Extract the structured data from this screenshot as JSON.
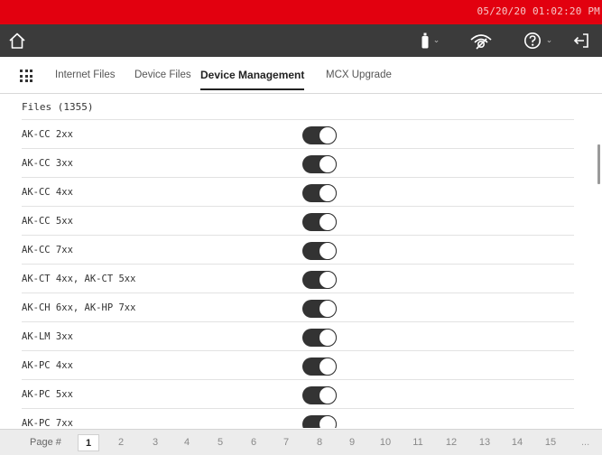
{
  "status_bar": {
    "datetime": "05/20/20 01:02:20 PM",
    "color": "#e2000f"
  },
  "toolbar": {
    "background": "#3b3b3b",
    "icons": [
      "home-icon",
      "usb-icon",
      "signal-icon",
      "help-icon",
      "logout-icon"
    ],
    "caret": "⌄"
  },
  "tabs": [
    {
      "label": "Internet Files",
      "active": false
    },
    {
      "label": "Device Files",
      "active": false
    },
    {
      "label": "Device Management",
      "active": true
    },
    {
      "label": "MCX Upgrade",
      "active": false
    }
  ],
  "list": {
    "header": "Files (1355)",
    "rows": [
      {
        "label": "AK-CC 2xx",
        "enabled": true
      },
      {
        "label": "AK-CC 3xx",
        "enabled": true
      },
      {
        "label": "AK-CC 4xx",
        "enabled": true
      },
      {
        "label": "AK-CC 5xx",
        "enabled": true
      },
      {
        "label": "AK-CC 7xx",
        "enabled": true
      },
      {
        "label": "AK-CT 4xx, AK-CT 5xx",
        "enabled": true
      },
      {
        "label": "AK-CH 6xx, AK-HP 7xx",
        "enabled": true
      },
      {
        "label": "AK-LM 3xx",
        "enabled": true
      },
      {
        "label": "AK-PC 4xx",
        "enabled": true
      },
      {
        "label": "AK-PC 5xx",
        "enabled": true
      },
      {
        "label": "AK-PC 7xx",
        "enabled": true
      }
    ]
  },
  "pager": {
    "label": "Page #",
    "pages": [
      "1",
      "2",
      "3",
      "4",
      "5",
      "6",
      "7",
      "8",
      "9",
      "10",
      "11",
      "12",
      "13",
      "14",
      "15"
    ],
    "current": "1",
    "ellipsis": "..."
  }
}
